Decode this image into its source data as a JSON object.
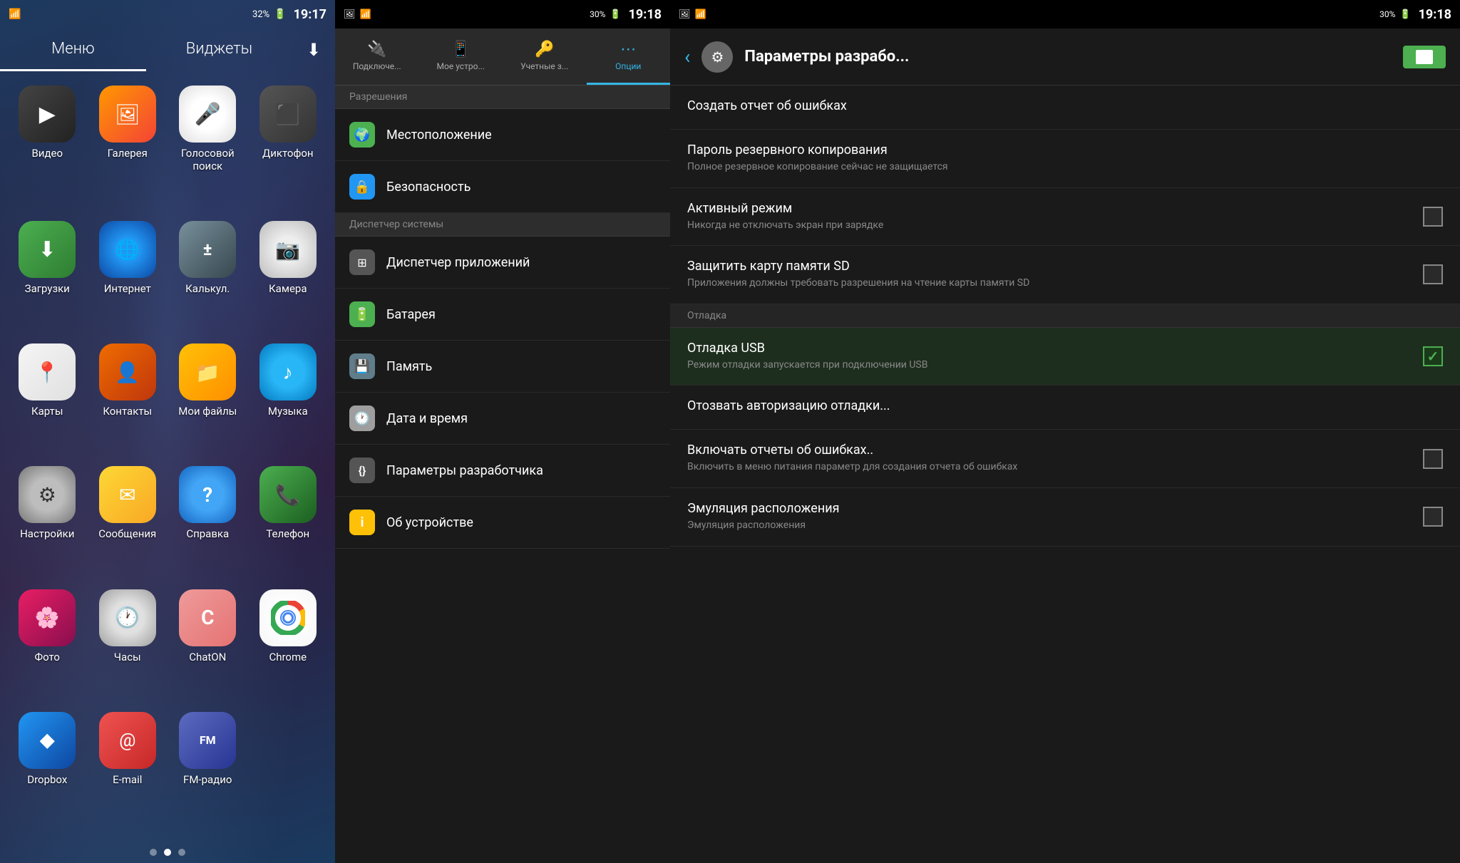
{
  "panel1": {
    "statusBar": {
      "battery": "32%",
      "time": "19:17",
      "wifiIcon": "wifi",
      "signalIcon": "signal"
    },
    "tabs": [
      {
        "label": "Меню",
        "active": true
      },
      {
        "label": "Виджеты",
        "active": false
      }
    ],
    "downloadIcon": "⬇",
    "apps": [
      {
        "name": "Видео",
        "iconClass": "icon-video",
        "symbol": "▶"
      },
      {
        "name": "Галерея",
        "iconClass": "icon-gallery",
        "symbol": "🖼"
      },
      {
        "name": "Голосовой поиск",
        "iconClass": "icon-voice",
        "symbol": "🎤"
      },
      {
        "name": "Диктофон",
        "iconClass": "icon-dictaphone",
        "symbol": "🎙"
      },
      {
        "name": "Загрузки",
        "iconClass": "icon-downloads",
        "symbol": "⬇"
      },
      {
        "name": "Интернет",
        "iconClass": "icon-internet",
        "symbol": "🌐"
      },
      {
        "name": "Калькул.",
        "iconClass": "icon-calc",
        "symbol": "±"
      },
      {
        "name": "Камера",
        "iconClass": "icon-camera",
        "symbol": "📷"
      },
      {
        "name": "Карты",
        "iconClass": "icon-maps",
        "symbol": "📍"
      },
      {
        "name": "Контакты",
        "iconClass": "icon-contacts",
        "symbol": "👤"
      },
      {
        "name": "Мои файлы",
        "iconClass": "icon-files",
        "symbol": "📁"
      },
      {
        "name": "Музыка",
        "iconClass": "icon-music",
        "symbol": "♪"
      },
      {
        "name": "Настройки",
        "iconClass": "icon-settings",
        "symbol": "⚙"
      },
      {
        "name": "Сообщения",
        "iconClass": "icon-messages",
        "symbol": "✉"
      },
      {
        "name": "Справка",
        "iconClass": "icon-help",
        "symbol": "?"
      },
      {
        "name": "Телефон",
        "iconClass": "icon-phone",
        "symbol": "📞"
      },
      {
        "name": "Фото",
        "iconClass": "icon-photos",
        "symbol": "🌸"
      },
      {
        "name": "Часы",
        "iconClass": "icon-clock",
        "symbol": "🕐"
      },
      {
        "name": "ChatON",
        "iconClass": "icon-chaton",
        "symbol": "C"
      },
      {
        "name": "Chrome",
        "iconClass": "icon-chrome",
        "symbol": "◎"
      },
      {
        "name": "Dropbox",
        "iconClass": "icon-dropbox",
        "symbol": "◆"
      },
      {
        "name": "E-mail",
        "iconClass": "icon-email",
        "symbol": "@"
      },
      {
        "name": "FM-радио",
        "iconClass": "icon-fm",
        "symbol": "FM"
      }
    ],
    "dots": [
      {
        "active": false
      },
      {
        "active": true
      },
      {
        "active": false
      }
    ]
  },
  "panel2": {
    "statusBar": {
      "battery": "30%",
      "time": "19:18"
    },
    "tabs": [
      {
        "label": "Подключе...",
        "icon": "🔌",
        "active": false
      },
      {
        "label": "Мое устро...",
        "icon": "📱",
        "active": false
      },
      {
        "label": "Учетные з...",
        "icon": "🔑",
        "active": false
      },
      {
        "label": "Опции",
        "icon": "⋯",
        "active": true
      }
    ],
    "sectionHeader": "Разрешения",
    "items": [
      {
        "label": "Местоположение",
        "icon": "🌍",
        "iconBg": "#4caf50"
      },
      {
        "label": "Безопасность",
        "icon": "🔒",
        "iconBg": "#2196f3"
      },
      {
        "label": "Диспетчер системы",
        "icon": "",
        "iconBg": "",
        "isHeader": true
      },
      {
        "label": "Диспетчер приложений",
        "icon": "⊞",
        "iconBg": "#555"
      },
      {
        "label": "Батарея",
        "icon": "🔋",
        "iconBg": "#4caf50"
      },
      {
        "label": "Память",
        "icon": "💾",
        "iconBg": "#607d8b"
      },
      {
        "label": "Дата и время",
        "icon": "🕐",
        "iconBg": "#9e9e9e"
      },
      {
        "label": "Параметры разработчика",
        "icon": "{}",
        "iconBg": "#555"
      },
      {
        "label": "Об устройстве",
        "icon": "ℹ",
        "iconBg": "#ffc107"
      }
    ]
  },
  "panel3": {
    "statusBar": {
      "battery": "30%",
      "time": "19:18"
    },
    "header": {
      "backLabel": "‹",
      "iconSymbol": "⚙",
      "title": "Параметры разрабо...",
      "toggleOn": true
    },
    "items": [
      {
        "type": "item",
        "title": "Создать отчет об ошибках",
        "subtitle": "",
        "hasCheckbox": false
      },
      {
        "type": "item",
        "title": "Пароль резервного копирования",
        "subtitle": "Полное резервное копирование сейчас не защищается",
        "hasCheckbox": false
      },
      {
        "type": "item",
        "title": "Активный режим",
        "subtitle": "Никогда не отключать экран при зарядке",
        "hasCheckbox": true,
        "checked": false
      },
      {
        "type": "item",
        "title": "Защитить карту памяти SD",
        "subtitle": "Приложения должны требовать разрешения на чтение карты памяти SD",
        "hasCheckbox": true,
        "checked": false
      },
      {
        "type": "section",
        "label": "Отладка"
      },
      {
        "type": "item",
        "title": "Отладка USB",
        "subtitle": "Режим отладки запускается при подключении USB",
        "hasCheckbox": true,
        "checked": true
      },
      {
        "type": "item",
        "title": "Отозвать авторизацию отладки...",
        "subtitle": "",
        "hasCheckbox": false
      },
      {
        "type": "item",
        "title": "Включать отчеты об ошибках..",
        "subtitle": "Включить в меню питания параметр для создания отчета об ошибках",
        "hasCheckbox": true,
        "checked": false
      },
      {
        "type": "item",
        "title": "Эмуляция расположения",
        "subtitle": "Эмуляция расположения",
        "hasCheckbox": true,
        "checked": false
      }
    ]
  }
}
